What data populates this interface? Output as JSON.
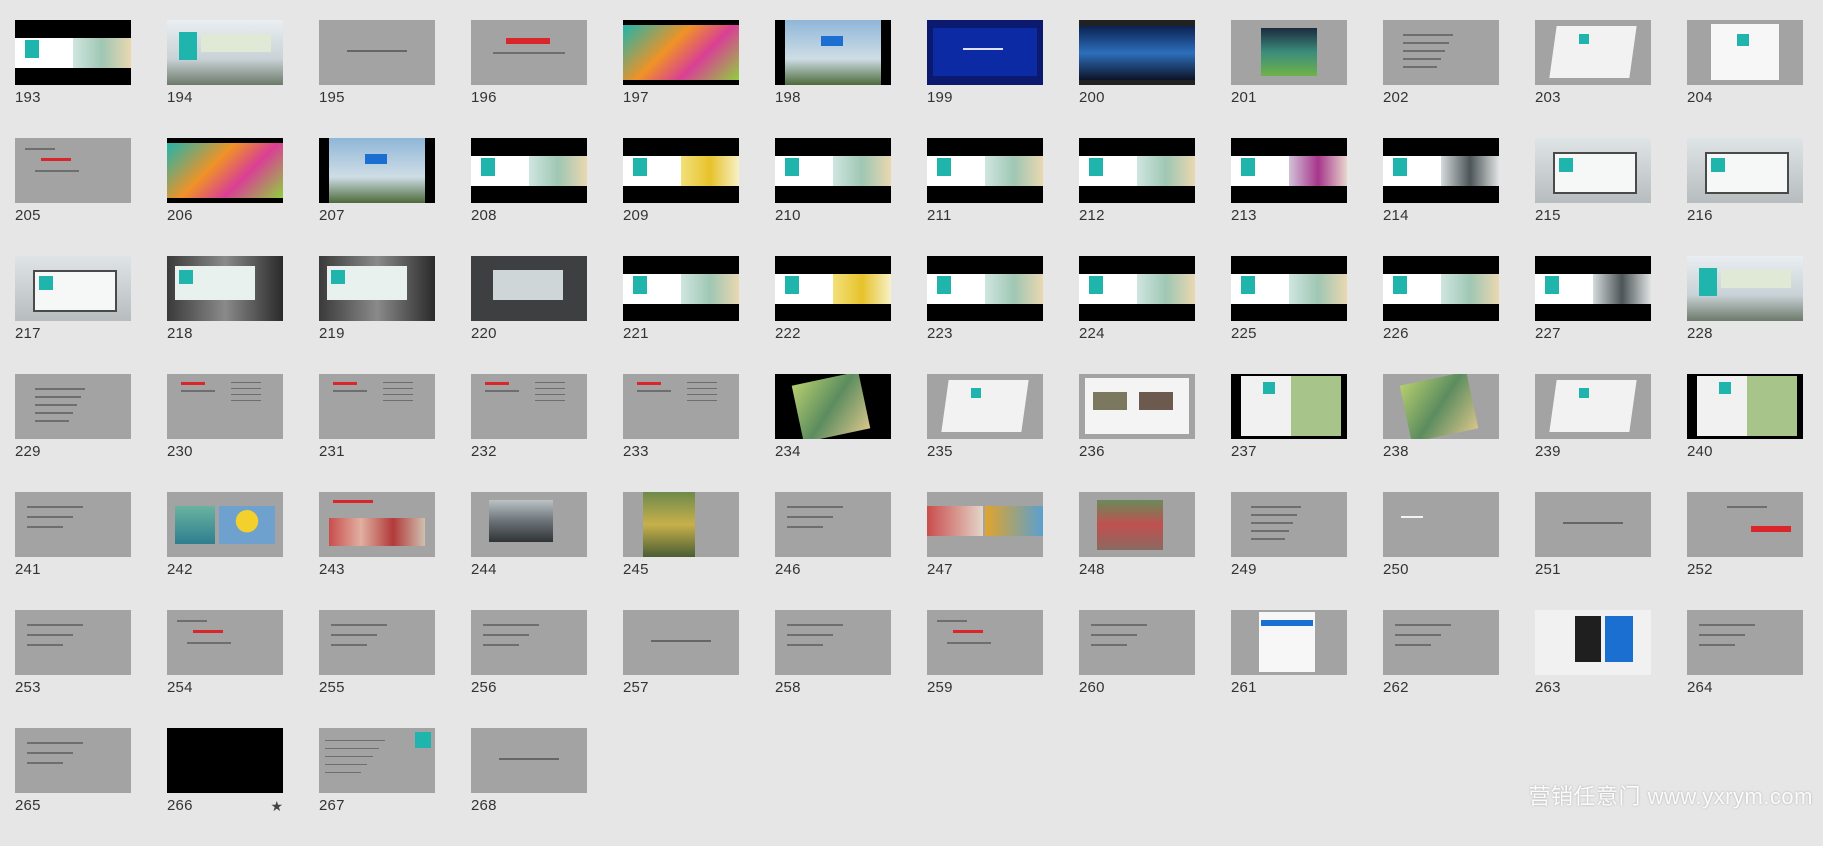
{
  "slides": [
    {
      "num": "193",
      "style": "black",
      "deco": "whiteband-teal"
    },
    {
      "num": "194",
      "style": "white",
      "deco": "billboard"
    },
    {
      "num": "195",
      "style": "grey",
      "deco": "centertext"
    },
    {
      "num": "196",
      "style": "grey",
      "deco": "redtitle"
    },
    {
      "num": "197",
      "style": "black",
      "deco": "colorful"
    },
    {
      "num": "198",
      "style": "black",
      "deco": "sky"
    },
    {
      "num": "199",
      "style": "darkblue",
      "deco": "bluepanel"
    },
    {
      "num": "200",
      "style": "dark",
      "deco": "stage"
    },
    {
      "num": "201",
      "style": "grey",
      "deco": "photoframe"
    },
    {
      "num": "202",
      "style": "grey",
      "deco": "textlist"
    },
    {
      "num": "203",
      "style": "grey",
      "deco": "book"
    },
    {
      "num": "204",
      "style": "grey",
      "deco": "book2"
    },
    {
      "num": "205",
      "style": "grey",
      "deco": "textred"
    },
    {
      "num": "206",
      "style": "black",
      "deco": "colorful"
    },
    {
      "num": "207",
      "style": "black",
      "deco": "sky"
    },
    {
      "num": "208",
      "style": "black",
      "deco": "whiteband-teal"
    },
    {
      "num": "209",
      "style": "black",
      "deco": "whiteband-yellow"
    },
    {
      "num": "210",
      "style": "black",
      "deco": "whiteband-teal"
    },
    {
      "num": "211",
      "style": "black",
      "deco": "whiteband-teal"
    },
    {
      "num": "212",
      "style": "black",
      "deco": "whiteband-teal"
    },
    {
      "num": "213",
      "style": "black",
      "deco": "whiteband-purple"
    },
    {
      "num": "214",
      "style": "black",
      "deco": "whiteband-car"
    },
    {
      "num": "215",
      "style": "white",
      "deco": "busstop"
    },
    {
      "num": "216",
      "style": "white",
      "deco": "busstop"
    },
    {
      "num": "217",
      "style": "white",
      "deco": "busstop"
    },
    {
      "num": "218",
      "style": "dark",
      "deco": "subway"
    },
    {
      "num": "219",
      "style": "dark",
      "deco": "subway"
    },
    {
      "num": "220",
      "style": "dark",
      "deco": "subwaycar"
    },
    {
      "num": "221",
      "style": "black",
      "deco": "whiteband-teal"
    },
    {
      "num": "222",
      "style": "black",
      "deco": "whiteband-yellow"
    },
    {
      "num": "223",
      "style": "black",
      "deco": "whiteband-teal"
    },
    {
      "num": "224",
      "style": "black",
      "deco": "whiteband-teal"
    },
    {
      "num": "225",
      "style": "black",
      "deco": "whiteband-teal"
    },
    {
      "num": "226",
      "style": "black",
      "deco": "whiteband-teal"
    },
    {
      "num": "227",
      "style": "black",
      "deco": "whiteband-car"
    },
    {
      "num": "228",
      "style": "white",
      "deco": "billboard"
    },
    {
      "num": "229",
      "style": "grey",
      "deco": "textlist"
    },
    {
      "num": "230",
      "style": "grey",
      "deco": "twocol"
    },
    {
      "num": "231",
      "style": "grey",
      "deco": "twocol"
    },
    {
      "num": "232",
      "style": "grey",
      "deco": "twocol"
    },
    {
      "num": "233",
      "style": "grey",
      "deco": "twocol"
    },
    {
      "num": "234",
      "style": "black",
      "deco": "magazine"
    },
    {
      "num": "235",
      "style": "grey",
      "deco": "book"
    },
    {
      "num": "236",
      "style": "grey",
      "deco": "book3"
    },
    {
      "num": "237",
      "style": "black",
      "deco": "magazine2"
    },
    {
      "num": "238",
      "style": "grey",
      "deco": "magazine"
    },
    {
      "num": "239",
      "style": "grey",
      "deco": "book"
    },
    {
      "num": "240",
      "style": "black",
      "deco": "magazine2"
    },
    {
      "num": "241",
      "style": "grey",
      "deco": "textlines"
    },
    {
      "num": "242",
      "style": "grey",
      "deco": "balloon"
    },
    {
      "num": "243",
      "style": "grey",
      "deco": "crowd"
    },
    {
      "num": "244",
      "style": "grey",
      "deco": "car"
    },
    {
      "num": "245",
      "style": "grey",
      "deco": "sign"
    },
    {
      "num": "246",
      "style": "grey",
      "deco": "textlines"
    },
    {
      "num": "247",
      "style": "grey",
      "deco": "photos2"
    },
    {
      "num": "248",
      "style": "grey",
      "deco": "crowd2"
    },
    {
      "num": "249",
      "style": "grey",
      "deco": "textlist"
    },
    {
      "num": "250",
      "style": "grey",
      "deco": "smalltext"
    },
    {
      "num": "251",
      "style": "grey",
      "deco": "centertext"
    },
    {
      "num": "252",
      "style": "grey",
      "deco": "redbutton"
    },
    {
      "num": "253",
      "style": "grey",
      "deco": "textlines"
    },
    {
      "num": "254",
      "style": "grey",
      "deco": "textred"
    },
    {
      "num": "255",
      "style": "grey",
      "deco": "textlines"
    },
    {
      "num": "256",
      "style": "grey",
      "deco": "textlines"
    },
    {
      "num": "257",
      "style": "grey",
      "deco": "centertext"
    },
    {
      "num": "258",
      "style": "grey",
      "deco": "textlines"
    },
    {
      "num": "259",
      "style": "grey",
      "deco": "textred"
    },
    {
      "num": "260",
      "style": "grey",
      "deco": "textlines"
    },
    {
      "num": "261",
      "style": "grey",
      "deco": "phone"
    },
    {
      "num": "262",
      "style": "grey",
      "deco": "textlines"
    },
    {
      "num": "263",
      "style": "grey",
      "deco": "phones"
    },
    {
      "num": "264",
      "style": "grey",
      "deco": "textlines"
    },
    {
      "num": "265",
      "style": "grey",
      "deco": "textlines"
    },
    {
      "num": "266",
      "style": "black",
      "deco": "none",
      "star": "★"
    },
    {
      "num": "267",
      "style": "grey",
      "deco": "tealcorner"
    },
    {
      "num": "268",
      "style": "grey",
      "deco": "centertext"
    }
  ],
  "watermark": "营销任意门 www.yxrym.com",
  "colors": {
    "teal": "#1fb5ac",
    "grey": "#a3a3a3",
    "background": "#e6e6e6"
  }
}
